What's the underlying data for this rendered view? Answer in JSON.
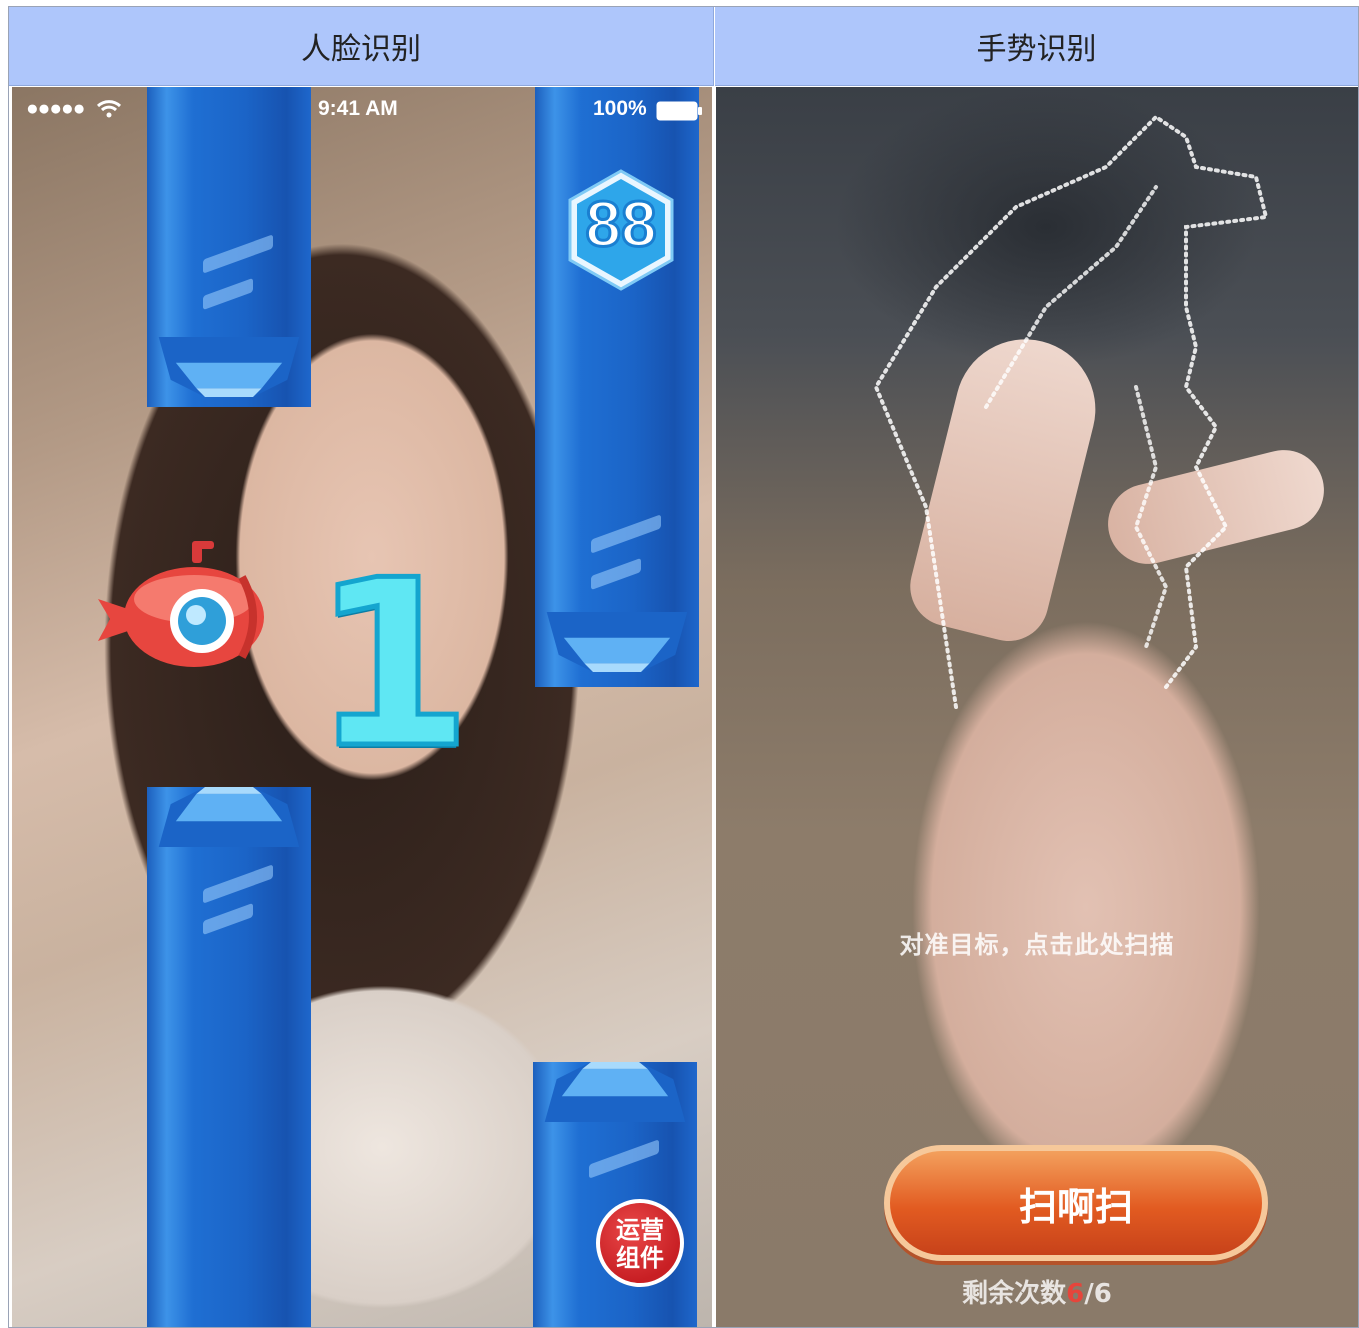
{
  "headers": {
    "left": "人脸识别",
    "right": "手势识别"
  },
  "face_game": {
    "status_bar": {
      "signal": "●●●●●",
      "time": "9:41 AM",
      "battery": "100%"
    },
    "score": "88",
    "countdown": "1",
    "ops_badge": {
      "line1": "运营",
      "line2": "组件"
    },
    "colors": {
      "pillar": "#1f6fd3",
      "countdown": "#5fe7f3",
      "badge": "#c81f24"
    }
  },
  "gesture": {
    "hint": "对准目标，点击此处扫描",
    "button_label": "扫啊扫",
    "remaining_label": "剩余次数",
    "remaining_count": "6",
    "remaining_total": "/6",
    "colors": {
      "button": "#e25b21",
      "count": "#e6453b"
    }
  }
}
